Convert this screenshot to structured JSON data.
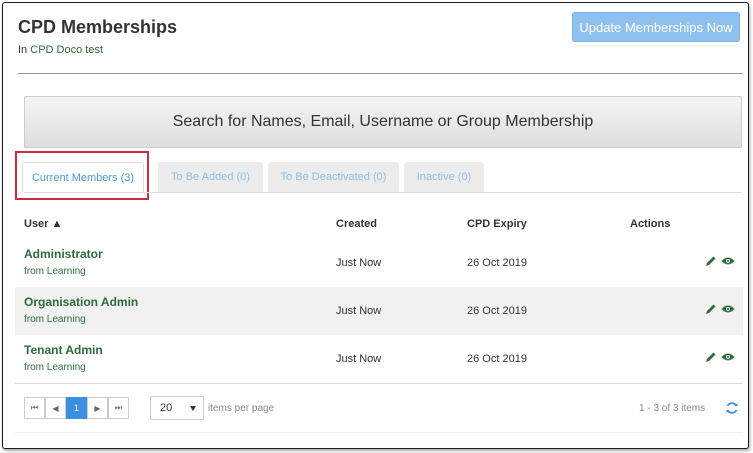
{
  "page": {
    "title": "CPD Memberships",
    "subtitle_prefix": "In",
    "subtitle_link": "CPD Doco test",
    "update_button": "Update Memberships Now"
  },
  "search": {
    "placeholder": "Search for Names, Email, Username or Group Membership"
  },
  "tabs": [
    {
      "label": "Current Members (3)",
      "active": true
    },
    {
      "label": "To Be Added (0)",
      "active": false
    },
    {
      "label": "To Be Deactivated (0)",
      "active": false
    },
    {
      "label": "Inactive (0)",
      "active": false
    }
  ],
  "table": {
    "headers": {
      "user": "User ▲",
      "created": "Created",
      "expiry": "CPD Expiry",
      "actions": "Actions"
    },
    "rows": [
      {
        "name": "Administrator",
        "source": "from Learning",
        "created": "Just Now",
        "expiry": "26 Oct 2019"
      },
      {
        "name": "Organisation Admin",
        "source": "from Learning",
        "created": "Just Now",
        "expiry": "26 Oct 2019"
      },
      {
        "name": "Tenant Admin",
        "source": "from Learning",
        "created": "Just Now",
        "expiry": "26 Oct 2019"
      }
    ]
  },
  "pager": {
    "first": "⏮",
    "prev": "◀",
    "page": "1",
    "next": "▶",
    "last": "⏭",
    "page_size": "20",
    "per_page_label": "items per page",
    "info": "1 - 3 of 3 items"
  },
  "colors": {
    "accent": "#3a8fe0",
    "link_green": "#2e6b3a",
    "highlight_red": "#c9303c",
    "button_blue": "#8ec1ee"
  },
  "icons": [
    "pencil-icon",
    "eye-icon",
    "refresh-icon",
    "sort-asc-icon",
    "caret-down-icon"
  ]
}
